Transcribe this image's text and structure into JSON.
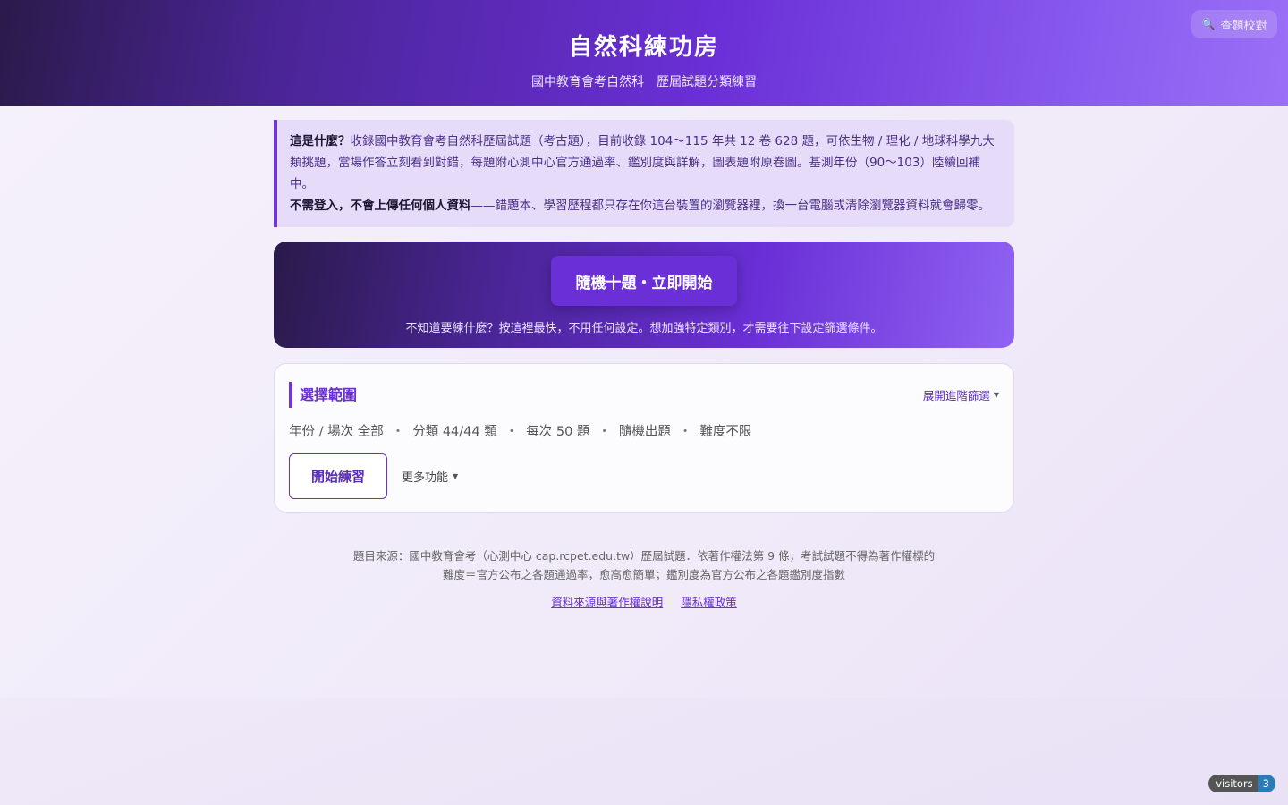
{
  "header": {
    "title": "自然科練功房",
    "subtitle_parts": [
      "國中教育會考自然科",
      "歷屆試題分類練習"
    ],
    "lookup_button": "查題校對",
    "lookup_icon": "magnifier-icon"
  },
  "intro": {
    "line1_bold": "這是什麼？",
    "line1_text": "收錄國中教育會考自然科歷屆試題（考古題），目前收錄 104～115 年共 12 卷 628 題，可依生物 / 理化 / 地球科學九大類挑題，當場作答立刻看到對錯，每題附心測中心官方通過率、鑑別度與詳解，圖表題附原卷圖。基測年份（90～103）陸續回補中。",
    "line2_bold": "不需登入，不會上傳任何個人資料",
    "line2_text": "——錯題本、學習歷程都只存在你這台裝置的瀏覽器裡，換一台電腦或清除瀏覽器資料就會歸零。"
  },
  "cta": {
    "button": "隨機十題・立即開始",
    "hint": "不知道要練什麼？按這裡最快，不用任何設定。想加強特定類別，才需要往下設定篩選條件。"
  },
  "scope": {
    "title": "選擇範圍",
    "expand_link": "展開進階篩選",
    "summary": [
      "年份 / 場次 全部",
      "分類 44/44 類",
      "每次 50 題",
      "隨機出題",
      "難度不限"
    ],
    "separator": "・",
    "start_button": "開始練習",
    "more_button": "更多功能"
  },
  "footer": {
    "line1": "題目來源：國中教育會考（心測中心 cap.rcpet.edu.tw）歷屆試題．依著作權法第 9 條，考試試題不得為著作權標的",
    "line2": "難度＝官方公布之各題通過率，愈高愈簡單；鑑別度為官方公布之各題鑑別度指數",
    "links": [
      "資料來源與著作權說明",
      "隱私權政策"
    ]
  },
  "visitors": {
    "label": "visitors",
    "count": "3"
  },
  "colors": {
    "accent": "#6a2fd6",
    "header_dark": "#2b1a4a",
    "header_light": "#9b6ff6",
    "intro_bg": "#e6dcfa",
    "badge_count_bg": "#2b7bb9"
  }
}
